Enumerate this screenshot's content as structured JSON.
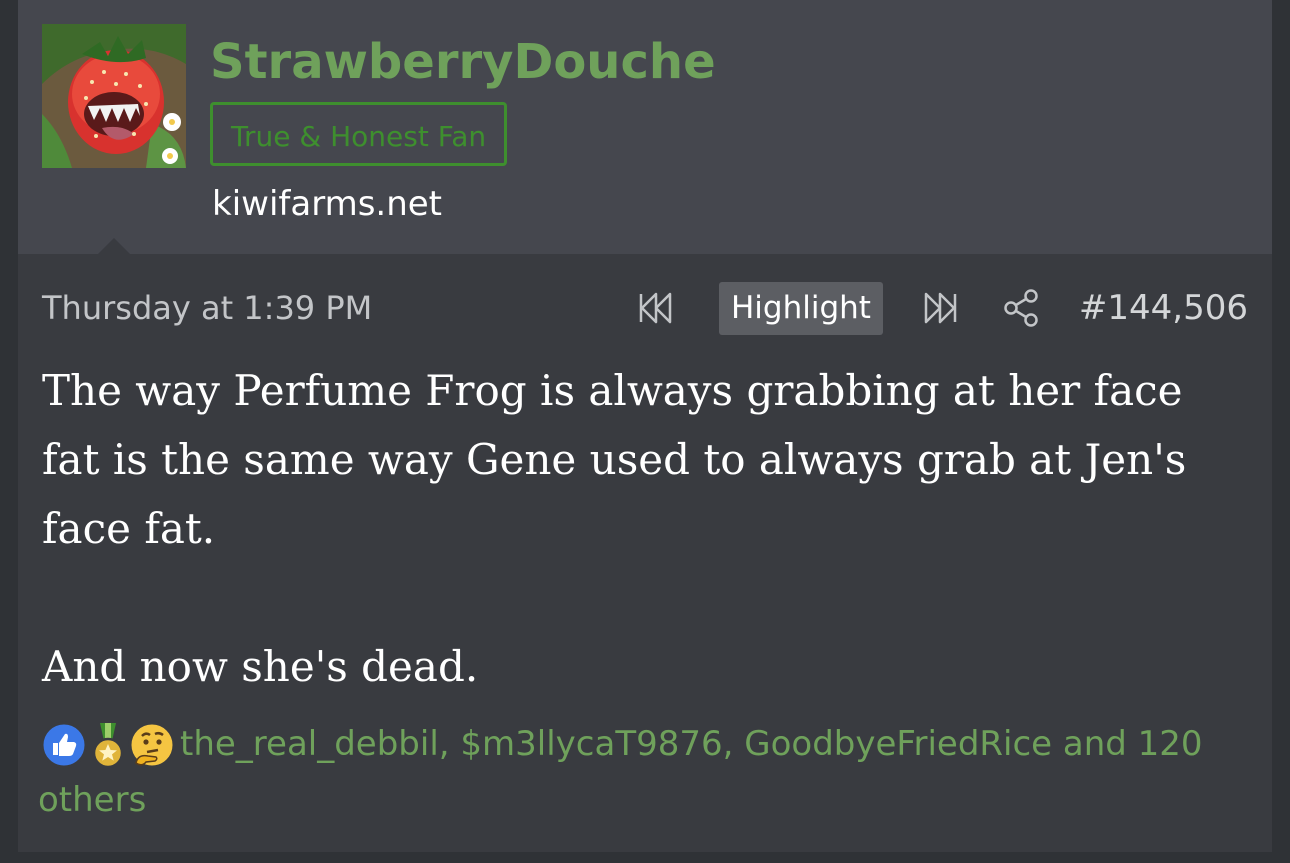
{
  "user": {
    "name": "StrawberryDouche",
    "title": "True & Honest Fan",
    "site": "kiwifarms.net"
  },
  "post": {
    "date": "Thursday at 1:39 PM",
    "highlight_label": "Highlight",
    "number": "#144,506",
    "paragraphs": [
      "The way Perfume Frog is always grabbing at her face fat is the same way Gene used to always grab at Jen's face fat.",
      "And now she's dead."
    ]
  },
  "reactions": {
    "icons": [
      "like-icon",
      "winner-icon",
      "thinking-icon"
    ],
    "text": "the_real_debbil, $m3llycaT9876, GoodbyeFriedRice and 120 others"
  },
  "colors": {
    "username": "#6fa15b",
    "badge": "#3e8f2e",
    "header_bg": "#45474e",
    "body_bg": "#393b40"
  }
}
